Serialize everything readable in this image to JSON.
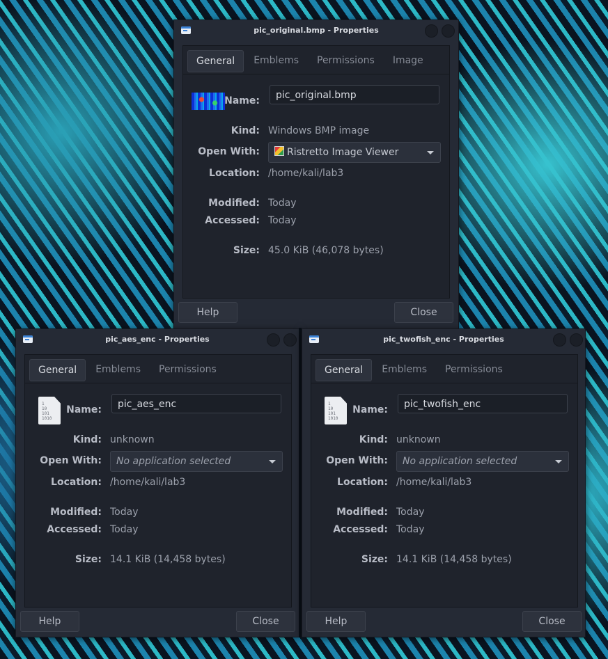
{
  "windows": [
    {
      "title": "pic_original.bmp - Properties",
      "tabs": [
        "General",
        "Emblems",
        "Permissions",
        "Image"
      ],
      "name_label": "Name:",
      "name_value": "pic_original.bmp",
      "kind_label": "Kind:",
      "kind_value": "Windows BMP image",
      "open_with_label": "Open With:",
      "open_with_value": "Ristretto Image Viewer",
      "location_label": "Location:",
      "location_value": "/home/kali/lab3",
      "modified_label": "Modified:",
      "modified_value": "Today",
      "accessed_label": "Accessed:",
      "accessed_value": "Today",
      "size_label": "Size:",
      "size_value": "45.0 KiB (46,078 bytes)",
      "help_label": "Help",
      "close_label": "Close"
    },
    {
      "title": "pic_aes_enc - Properties",
      "tabs": [
        "General",
        "Emblems",
        "Permissions"
      ],
      "name_label": "Name:",
      "name_value": "pic_aes_enc",
      "kind_label": "Kind:",
      "kind_value": "unknown",
      "open_with_label": "Open With:",
      "open_with_value": "No application selected",
      "location_label": "Location:",
      "location_value": "/home/kali/lab3",
      "modified_label": "Modified:",
      "modified_value": "Today",
      "accessed_label": "Accessed:",
      "accessed_value": "Today",
      "size_label": "Size:",
      "size_value": "14.1 KiB (14,458 bytes)",
      "help_label": "Help",
      "close_label": "Close",
      "file_icon_text": "1\n10\n101\n1010"
    },
    {
      "title": "pic_twofish_enc - Properties",
      "tabs": [
        "General",
        "Emblems",
        "Permissions"
      ],
      "name_label": "Name:",
      "name_value": "pic_twofish_enc",
      "kind_label": "Kind:",
      "kind_value": "unknown",
      "open_with_label": "Open With:",
      "open_with_value": "No application selected",
      "location_label": "Location:",
      "location_value": "/home/kali/lab3",
      "modified_label": "Modified:",
      "modified_value": "Today",
      "accessed_label": "Accessed:",
      "accessed_value": "Today",
      "size_label": "Size:",
      "size_value": "14.1 KiB (14,458 bytes)",
      "help_label": "Help",
      "close_label": "Close",
      "file_icon_text": "1\n10\n101\n1010"
    }
  ]
}
